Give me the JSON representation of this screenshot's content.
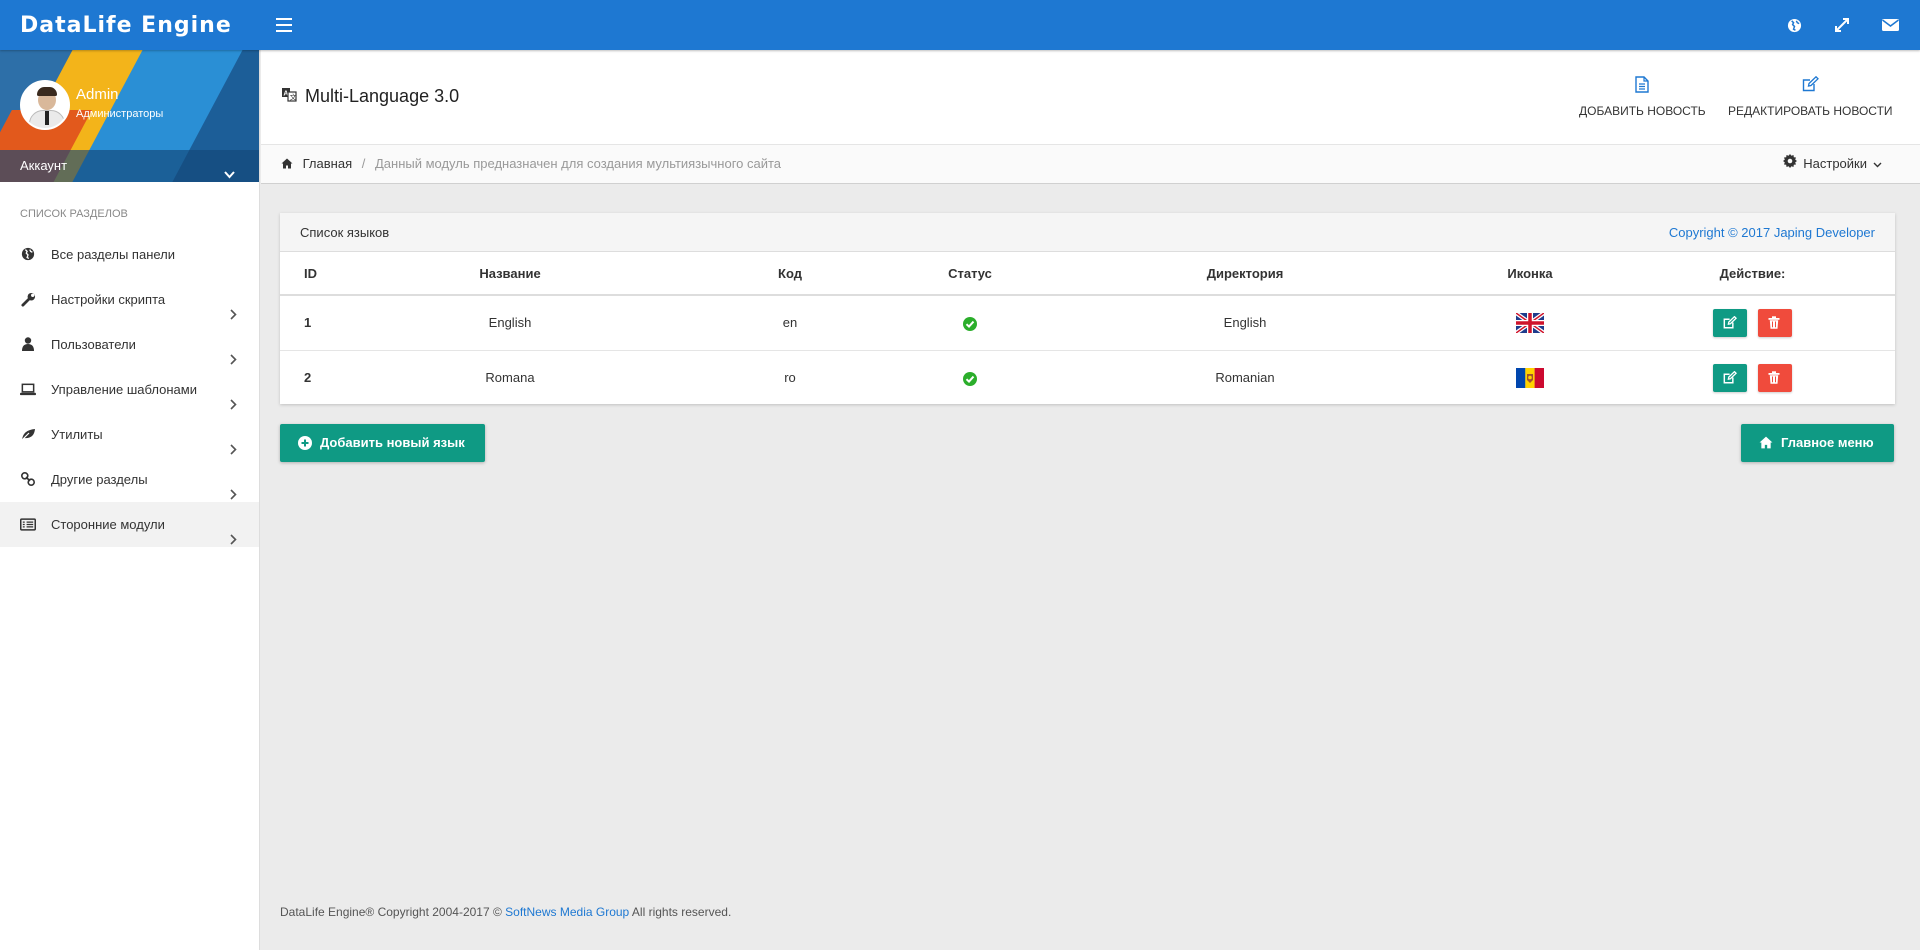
{
  "app": {
    "brand": "DataLife Engine"
  },
  "topbar": {
    "icons": [
      "globe-icon",
      "expand-icon",
      "envelope-icon"
    ]
  },
  "user": {
    "name": "Admin",
    "role": "Администраторы",
    "account_label": "Аккаунт"
  },
  "sidebar": {
    "section_title": "Список разделов",
    "items": [
      {
        "label": "Все разделы панели",
        "icon": "globe-icon",
        "has_arrow": false
      },
      {
        "label": "Настройки скрипта",
        "icon": "wrench-icon",
        "has_arrow": true
      },
      {
        "label": "Пользователи",
        "icon": "user-icon",
        "has_arrow": true
      },
      {
        "label": "Управление шаблонами",
        "icon": "laptop-icon",
        "has_arrow": true
      },
      {
        "label": "Утилиты",
        "icon": "leaf-icon",
        "has_arrow": true
      },
      {
        "label": "Другие разделы",
        "icon": "link-icon",
        "has_arrow": true
      },
      {
        "label": "Сторонние модули",
        "icon": "list-alt-icon",
        "has_arrow": true,
        "active": true
      }
    ]
  },
  "header": {
    "title": "Multi-Language 3.0",
    "add_news": "ДОБАВИТЬ НОВОСТЬ",
    "edit_news": "РЕДАКТИРОВАТЬ НОВОСТИ"
  },
  "breadcrumb": {
    "home": "Главная",
    "current": "Данный модуль предназначен для создания мультиязычного сайта",
    "settings": "Настройки"
  },
  "panel": {
    "title": "Список языков",
    "copyright": "Copyright © 2017 Japing Developer",
    "columns": [
      "ID",
      "Название",
      "Код",
      "Статус",
      "Директория",
      "Иконка",
      "Действие:"
    ],
    "rows": [
      {
        "id": "1",
        "name": "English",
        "code": "en",
        "status": "active",
        "directory": "English",
        "flag": "uk-flag"
      },
      {
        "id": "2",
        "name": "Romana",
        "code": "ro",
        "status": "active",
        "directory": "Romanian",
        "flag": "moldova-flag"
      }
    ]
  },
  "actions": {
    "add_language": "Добавить новый язык",
    "main_menu": "Главное меню"
  },
  "footer": {
    "prefix": "DataLife Engine® Copyright 2004-2017 ©",
    "link": "SoftNews Media Group",
    "suffix": "All rights reserved."
  },
  "colors": {
    "primary": "#1e78d2",
    "success": "#0f9a84",
    "danger": "#f04b3c",
    "status_ok": "#2bae2b"
  }
}
